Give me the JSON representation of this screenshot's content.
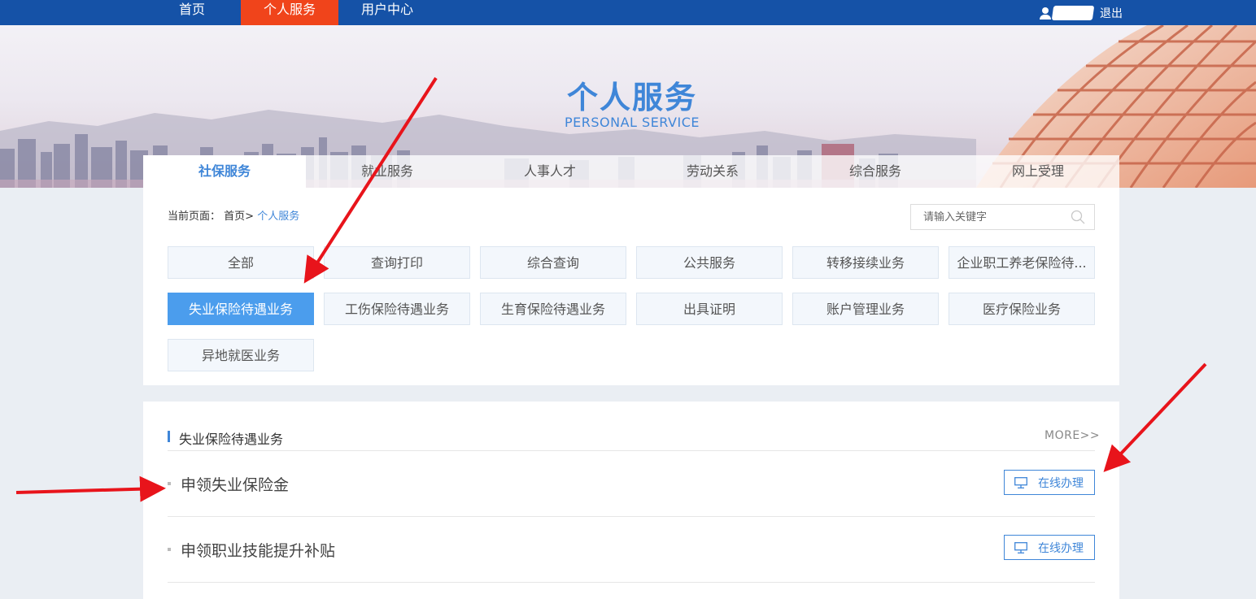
{
  "top_nav": {
    "items": [
      "首页",
      "个人服务",
      "用户中心"
    ],
    "active_index": 1,
    "logout_label": "退出"
  },
  "banner": {
    "title": "个人服务",
    "subtitle": "PERSONAL SERVICE"
  },
  "tabs": {
    "items": [
      "社保服务",
      "就业服务",
      "人事人才",
      "劳动关系",
      "综合服务",
      "网上受理"
    ],
    "active_index": 0
  },
  "breadcrumb": {
    "prefix": "当前页面：",
    "home": "首页",
    "separator": ">",
    "current": "个人服务"
  },
  "search": {
    "placeholder": "请输入关键字"
  },
  "categories": {
    "items": [
      "全部",
      "查询打印",
      "综合查询",
      "公共服务",
      "转移接续业务",
      "企业职工养老保险待...",
      "失业保险待遇业务",
      "工伤保险待遇业务",
      "生育保险待遇业务",
      "出具证明",
      "账户管理业务",
      "医疗保险业务",
      "异地就医业务"
    ],
    "active_index": 6
  },
  "section": {
    "title": "失业保险待遇业务",
    "more_label": "MORE>>",
    "services": [
      {
        "name": "申领失业保险金",
        "action_label": "在线办理"
      },
      {
        "name": "申领职业技能提升补贴",
        "action_label": "在线办理"
      }
    ]
  },
  "colors": {
    "top_bar": "#1552a7",
    "active_nav": "#f0441b",
    "accent_blue": "#3f86d8",
    "active_category": "#4b9ded",
    "annotation_arrow": "#e8141b"
  }
}
